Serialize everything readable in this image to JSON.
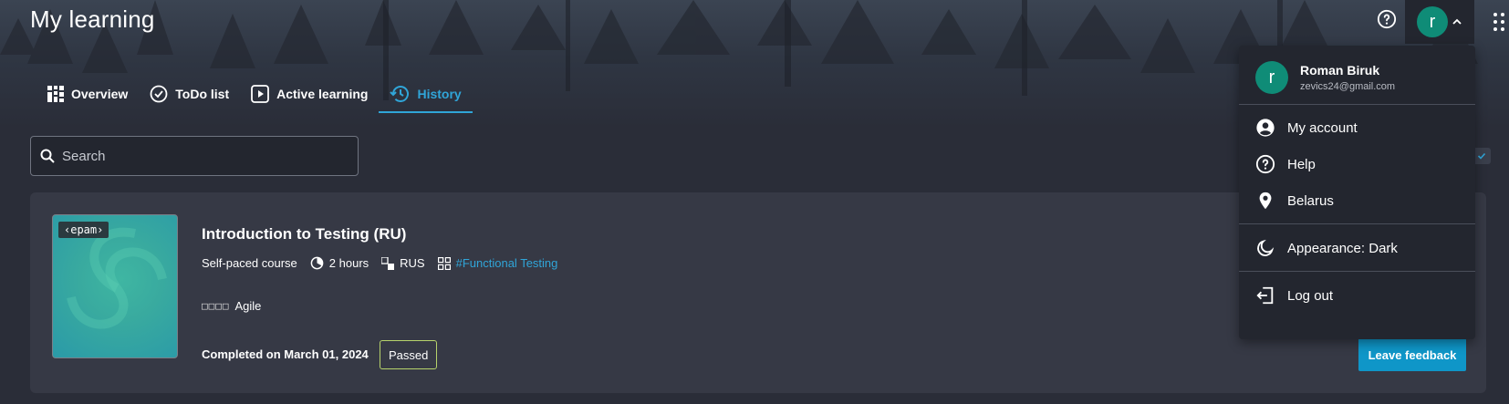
{
  "header": {
    "title": "My learning",
    "user_initial": "r"
  },
  "tabs": [
    {
      "label": "Overview",
      "icon": "grid-icon",
      "active": false
    },
    {
      "label": "ToDo list",
      "icon": "check-circle-icon",
      "active": false
    },
    {
      "label": "Active learning",
      "icon": "play-square-icon",
      "active": false
    },
    {
      "label": "History",
      "icon": "history-icon",
      "active": true
    }
  ],
  "search": {
    "placeholder": "Search",
    "value": ""
  },
  "course": {
    "logo_text": "‹epam›",
    "title": "Introduction to Testing (RU)",
    "type": "Self-paced course",
    "duration": "2 hours",
    "language": "RUS",
    "tag": "#Functional Testing",
    "skills_glyphs": "□□□□",
    "skills": "Agile",
    "completed": "Completed on March 01, 2024",
    "status": "Passed",
    "feedback_label": "Leave feedback"
  },
  "user_menu": {
    "initial": "r",
    "name": "Roman Biruk",
    "email": "zevics24@gmail.com",
    "items": [
      {
        "label": "My account",
        "icon": "user-circle-icon"
      },
      {
        "label": "Help",
        "icon": "help-circle-icon"
      },
      {
        "label": "Belarus",
        "icon": "location-pin-icon"
      },
      {
        "label": "Appearance: Dark",
        "icon": "moon-icon"
      },
      {
        "label": "Log out",
        "icon": "logout-icon"
      }
    ]
  },
  "colors": {
    "accent": "#30a5d8",
    "avatar": "#0f8c77",
    "passed_border": "#b7d36b",
    "button": "#0f96c8"
  }
}
